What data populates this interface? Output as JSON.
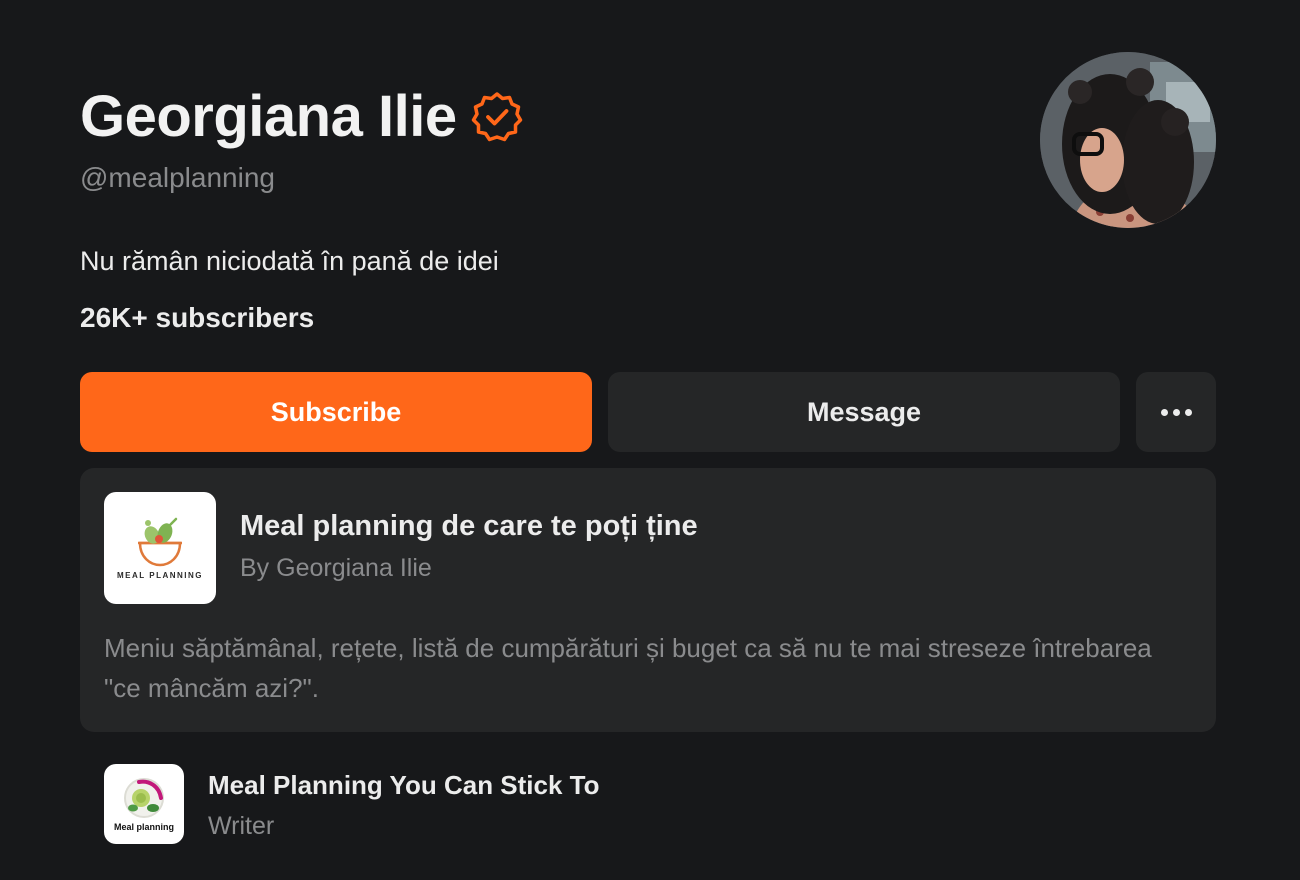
{
  "profile": {
    "name": "Georgiana Ilie",
    "handle": "@mealplanning",
    "bio": "Nu rămân niciodată în pană de idei",
    "subscribers": "26K+ subscribers",
    "verified_icon": "verified-badge-icon",
    "avatar_icon": "profile-photo"
  },
  "actions": {
    "subscribe_label": "Subscribe",
    "message_label": "Message",
    "more_icon": "ellipsis-icon"
  },
  "publication": {
    "logo_text": "MEAL PLANNING",
    "title": "Meal planning de care te poți ține",
    "author": "By Georgiana Ilie",
    "description": "Meniu săptămânal, rețete, listă de cumpărături și buget ca să nu te mai streseze întrebarea \"ce mâncăm azi?\"."
  },
  "writer_role": {
    "logo_text": "Meal planning",
    "title": "Meal Planning You Can Stick To",
    "role": "Writer"
  },
  "colors": {
    "background": "#17181a",
    "accent": "#ff6719",
    "card": "#252627",
    "muted_text": "#8a8b8d"
  }
}
